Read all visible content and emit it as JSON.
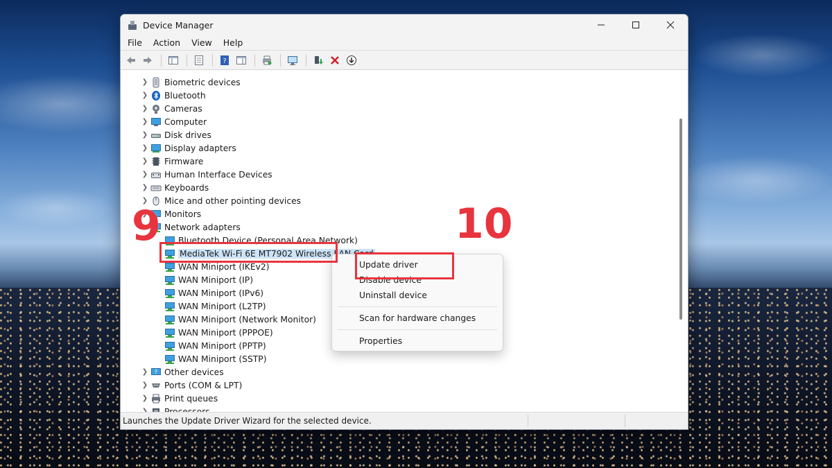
{
  "window": {
    "title": "Device Manager"
  },
  "menubar": [
    "File",
    "Action",
    "View",
    "Help"
  ],
  "tree": [
    {
      "label": "Biometric devices",
      "icon": "fingerprint-icon",
      "expanded": false
    },
    {
      "label": "Bluetooth",
      "icon": "bluetooth-icon",
      "expanded": false
    },
    {
      "label": "Cameras",
      "icon": "camera-icon",
      "expanded": false
    },
    {
      "label": "Computer",
      "icon": "computer-icon",
      "expanded": false
    },
    {
      "label": "Disk drives",
      "icon": "disk-drive-icon",
      "expanded": false
    },
    {
      "label": "Display adapters",
      "icon": "display-adapter-icon",
      "expanded": false
    },
    {
      "label": "Firmware",
      "icon": "firmware-icon",
      "expanded": false
    },
    {
      "label": "Human Interface Devices",
      "icon": "hid-icon",
      "expanded": false
    },
    {
      "label": "Keyboards",
      "icon": "keyboard-icon",
      "expanded": false
    },
    {
      "label": "Mice and other pointing devices",
      "icon": "mouse-icon",
      "expanded": false
    },
    {
      "label": "Monitors",
      "icon": "monitor-icon",
      "expanded": false
    },
    {
      "label": "Network adapters",
      "icon": "network-adapter-icon",
      "expanded": true,
      "children": [
        {
          "label": "Bluetooth Device (Personal Area Network)"
        },
        {
          "label": "MediaTek Wi-Fi 6E MT7902 Wireless LAN Card",
          "selected": true
        },
        {
          "label": "WAN Miniport (IKEv2)"
        },
        {
          "label": "WAN Miniport (IP)"
        },
        {
          "label": "WAN Miniport (IPv6)"
        },
        {
          "label": "WAN Miniport (L2TP)"
        },
        {
          "label": "WAN Miniport (Network Monitor)"
        },
        {
          "label": "WAN Miniport (PPPOE)"
        },
        {
          "label": "WAN Miniport (PPTP)"
        },
        {
          "label": "WAN Miniport (SSTP)"
        }
      ]
    },
    {
      "label": "Other devices",
      "icon": "other-device-icon",
      "expanded": false
    },
    {
      "label": "Ports (COM & LPT)",
      "icon": "port-icon",
      "expanded": false
    },
    {
      "label": "Print queues",
      "icon": "printer-icon",
      "expanded": false
    },
    {
      "label": "Processors",
      "icon": "processor-icon",
      "expanded": false
    }
  ],
  "context_menu": {
    "update_driver": "Update driver",
    "disable_device": "Disable device",
    "uninstall_device": "Uninstall device",
    "scan_hardware": "Scan for hardware changes",
    "properties": "Properties"
  },
  "statusbar": {
    "text": "Launches the Update Driver Wizard for the selected device."
  },
  "annotations": {
    "step9": "9",
    "step10": "10"
  },
  "colors": {
    "accent_red": "#e8343e",
    "selection": "#cce4f7"
  }
}
